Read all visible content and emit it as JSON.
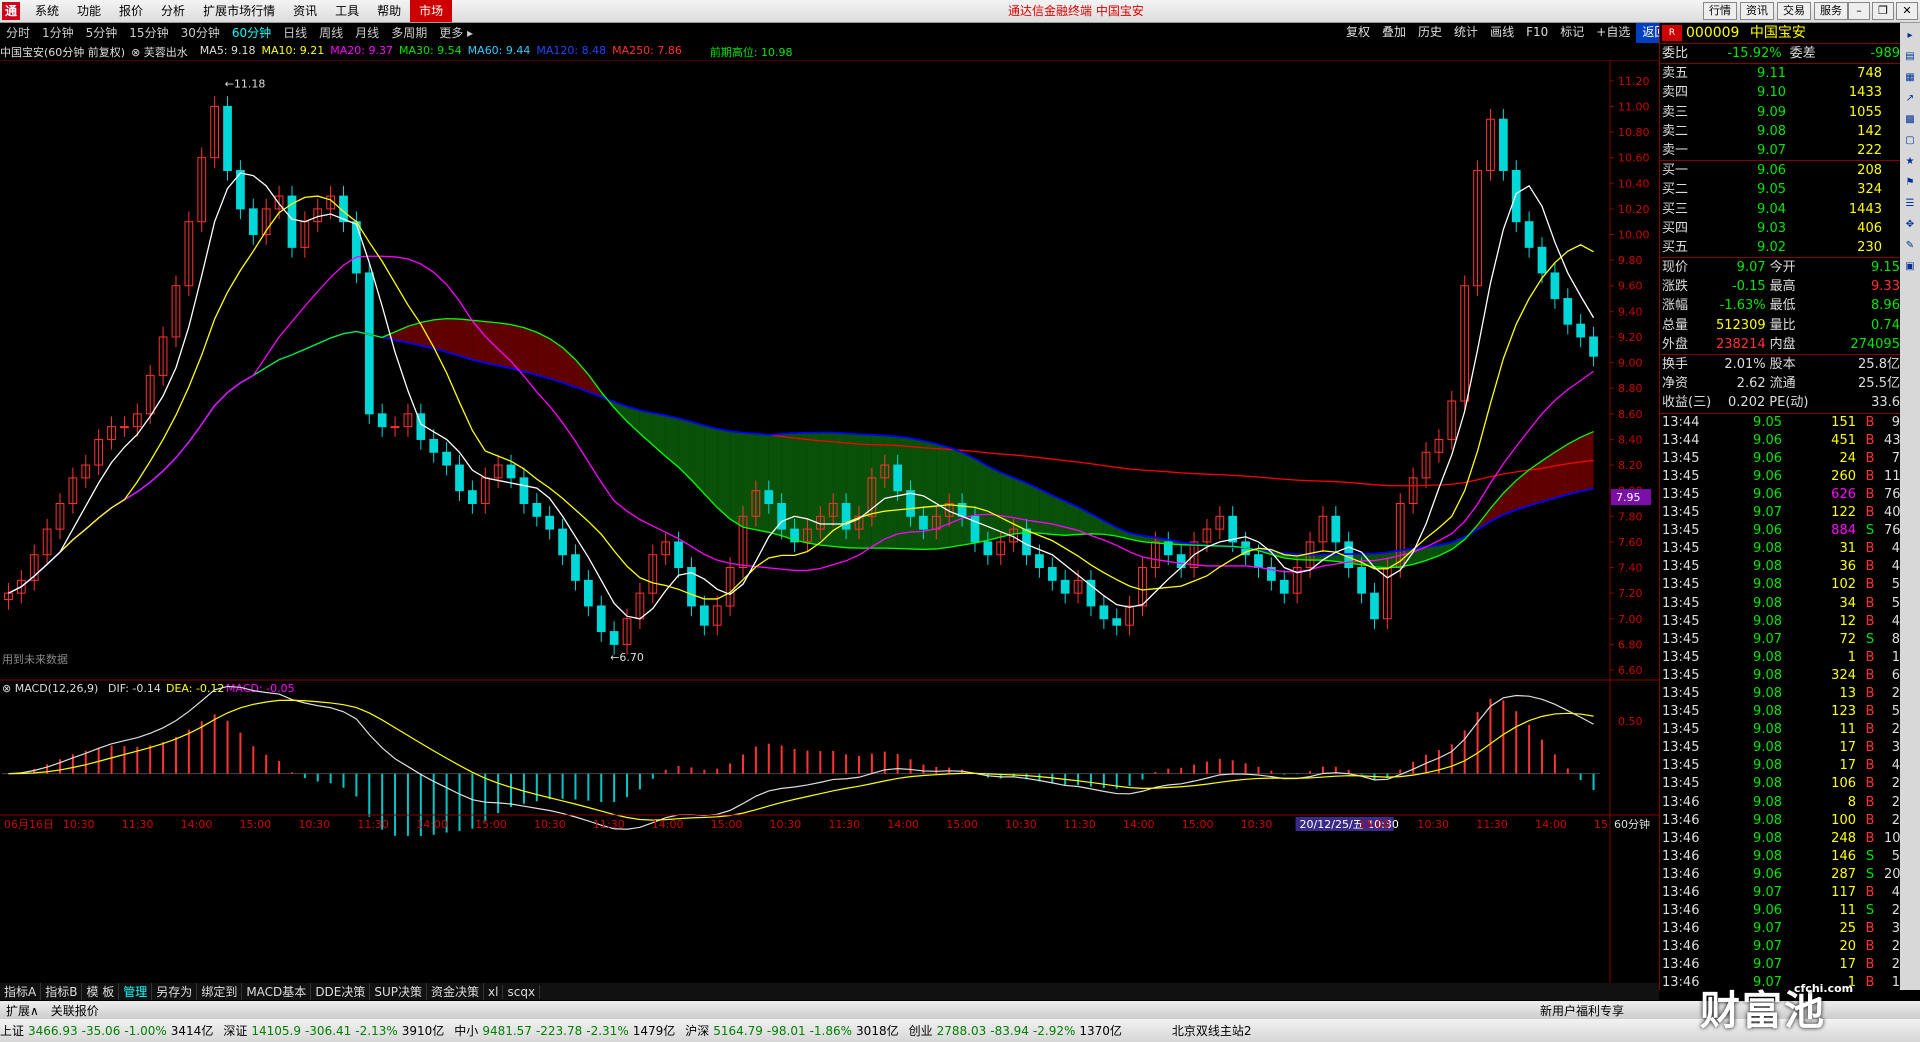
{
  "menu": {
    "items": [
      "系统",
      "功能",
      "报价",
      "分析",
      "扩展市场行情",
      "资讯",
      "工具",
      "帮助",
      "市场"
    ],
    "active_index": 8,
    "app_title": "通达信金融终端  中国宝安",
    "right_buttons": [
      "行情",
      "资讯",
      "交易",
      "服务"
    ]
  },
  "periods": {
    "items": [
      "分时",
      "1分钟",
      "5分钟",
      "15分钟",
      "30分钟",
      "60分钟",
      "日线",
      "周线",
      "月线",
      "多周期",
      "更多 ▸"
    ],
    "selected_index": 5
  },
  "toolbar_right": [
    "复权",
    "叠加",
    "历史",
    "统计",
    "画线",
    "F10",
    "标记",
    "+自选",
    "返回"
  ],
  "chart_info": {
    "name": "中国宝安(60分钟 前复权)",
    "indicator": "芙蓉出水",
    "ma5": "MA5: 9.18",
    "ma10": "MA10: 9.21",
    "ma20": "MA20: 9.37",
    "ma30": "MA30: 9.54",
    "ma60": "MA60: 9.44",
    "ma120": "MA120: 8.48",
    "ma250": "MA250: 7.86",
    "prev_high": "前期高位: 10.98",
    "future_note": "用到未来数据",
    "high_label": "11.18",
    "low_label": "6.70",
    "cur_price_tag": "7.95",
    "colors": {
      "ma5": "#ffffff",
      "ma10": "#ffff00",
      "ma20": "#ff00ff",
      "ma30": "#00ff00",
      "ma60": "#0000ff",
      "ma120": "#ff0000"
    }
  },
  "chart_data": {
    "type": "candlestick",
    "period": "60分钟",
    "ylim": [
      6.6,
      11.3
    ],
    "yticks": [
      11.2,
      11.0,
      10.8,
      10.6,
      10.4,
      10.2,
      10.0,
      9.8,
      9.6,
      9.4,
      9.2,
      9.0,
      8.8,
      8.6,
      8.4,
      8.2,
      8.0,
      7.8,
      7.6,
      7.4,
      7.2,
      7.0,
      6.8,
      6.6
    ],
    "close": [
      7.2,
      7.3,
      7.5,
      7.7,
      7.9,
      8.1,
      8.2,
      8.4,
      8.5,
      8.5,
      8.6,
      8.9,
      9.2,
      9.6,
      10.1,
      10.6,
      11.0,
      10.5,
      10.2,
      10.0,
      10.2,
      10.3,
      9.9,
      10.1,
      10.2,
      10.3,
      10.1,
      9.7,
      8.6,
      8.5,
      8.5,
      8.6,
      8.4,
      8.3,
      8.2,
      8.0,
      7.9,
      8.1,
      8.2,
      8.1,
      7.9,
      7.8,
      7.7,
      7.5,
      7.3,
      7.1,
      6.9,
      6.8,
      7.0,
      7.2,
      7.5,
      7.6,
      7.4,
      7.1,
      6.95,
      7.1,
      7.4,
      7.8,
      8.0,
      7.9,
      7.7,
      7.6,
      7.7,
      7.8,
      7.9,
      7.7,
      7.8,
      8.1,
      8.2,
      8.0,
      7.8,
      7.7,
      7.8,
      7.9,
      7.8,
      7.6,
      7.5,
      7.6,
      7.7,
      7.5,
      7.4,
      7.3,
      7.2,
      7.3,
      7.1,
      7.0,
      6.95,
      7.1,
      7.4,
      7.6,
      7.5,
      7.4,
      7.6,
      7.7,
      7.8,
      7.6,
      7.5,
      7.4,
      7.3,
      7.2,
      7.4,
      7.6,
      7.8,
      7.6,
      7.4,
      7.2,
      7.0,
      7.4,
      7.9,
      8.1,
      8.3,
      8.4,
      8.7,
      9.6,
      10.5,
      10.9,
      10.5,
      10.1,
      9.9,
      9.7,
      9.5,
      9.3,
      9.2,
      9.05
    ],
    "yaxis_label": "60分钟",
    "date_labels": [
      "06月16日",
      "10:30",
      "11:30",
      "14:00",
      "15:00",
      "10:30",
      "11:30",
      "14:00",
      "15:00",
      "10:30",
      "11:30",
      "14:00",
      "15:00",
      "10:30",
      "11:30",
      "14:00",
      "15:00",
      "10:30",
      "11:30",
      "14:00",
      "15:00",
      "10:30",
      "20/12/25/五 10:30",
      "15:00",
      "10:30",
      "11:30",
      "14:00",
      "15"
    ],
    "macd": {
      "label": "MACD(12,26,9)",
      "dif": "DIF: -0.14",
      "dea": "DEA: -0.12",
      "macd": "MACD: -0.05",
      "yticks": [
        0.5
      ],
      "ylim": [
        -0.25,
        0.7
      ]
    }
  },
  "quote": {
    "code": "000009",
    "name": "中国宝安",
    "weibi_label": "委比",
    "weibi": "-15.92%",
    "weicha_label": "委差",
    "weicha": "-989",
    "asks": [
      {
        "label": "卖五",
        "price": "9.11",
        "vol": "748"
      },
      {
        "label": "卖四",
        "price": "9.10",
        "vol": "1433"
      },
      {
        "label": "卖三",
        "price": "9.09",
        "vol": "1055"
      },
      {
        "label": "卖二",
        "price": "9.08",
        "vol": "142"
      },
      {
        "label": "卖一",
        "price": "9.07",
        "vol": "222"
      }
    ],
    "bids": [
      {
        "label": "买一",
        "price": "9.06",
        "vol": "208"
      },
      {
        "label": "买二",
        "price": "9.05",
        "vol": "324"
      },
      {
        "label": "买三",
        "price": "9.04",
        "vol": "1443"
      },
      {
        "label": "买四",
        "price": "9.03",
        "vol": "406"
      },
      {
        "label": "买五",
        "price": "9.02",
        "vol": "230"
      }
    ],
    "stats": [
      [
        {
          "l": "现价",
          "v": "9.07",
          "c": "green"
        },
        {
          "l": "今开",
          "v": "9.15",
          "c": "green"
        }
      ],
      [
        {
          "l": "涨跌",
          "v": "-0.15",
          "c": "green"
        },
        {
          "l": "最高",
          "v": "9.33",
          "c": "red"
        }
      ],
      [
        {
          "l": "涨幅",
          "v": "-1.63%",
          "c": "green"
        },
        {
          "l": "最低",
          "v": "8.96",
          "c": "green"
        }
      ],
      [
        {
          "l": "总量",
          "v": "512309",
          "c": "yellow"
        },
        {
          "l": "量比",
          "v": "0.74",
          "c": "green"
        }
      ],
      [
        {
          "l": "外盘",
          "v": "238214",
          "c": "red"
        },
        {
          "l": "内盘",
          "v": "274095",
          "c": "green"
        }
      ]
    ],
    "stats2": [
      [
        {
          "l": "换手",
          "v": "2.01%",
          "c": "white"
        },
        {
          "l": "股本",
          "v": "25.8亿",
          "c": "white"
        }
      ],
      [
        {
          "l": "净资",
          "v": "2.62",
          "c": "white"
        },
        {
          "l": "流通",
          "v": "25.5亿",
          "c": "white"
        }
      ],
      [
        {
          "l": "收益(三)",
          "v": "0.202",
          "c": "white"
        },
        {
          "l": "PE(动)",
          "v": "33.6",
          "c": "white"
        }
      ]
    ],
    "ticks": [
      {
        "t": "13:44",
        "p": "9.05",
        "v": "151",
        "bs": "B",
        "n": "9",
        "pc": "green",
        "vc": "yellow"
      },
      {
        "t": "13:44",
        "p": "9.06",
        "v": "451",
        "bs": "B",
        "n": "43",
        "pc": "green",
        "vc": "yellow"
      },
      {
        "t": "13:45",
        "p": "9.06",
        "v": "24",
        "bs": "B",
        "n": "7",
        "pc": "green",
        "vc": "yellow"
      },
      {
        "t": "13:45",
        "p": "9.06",
        "v": "260",
        "bs": "B",
        "n": "11",
        "pc": "green",
        "vc": "yellow"
      },
      {
        "t": "13:45",
        "p": "9.06",
        "v": "626",
        "bs": "B",
        "n": "76",
        "pc": "green",
        "vc": "magenta"
      },
      {
        "t": "13:45",
        "p": "9.07",
        "v": "122",
        "bs": "B",
        "n": "40",
        "pc": "green",
        "vc": "yellow"
      },
      {
        "t": "13:45",
        "p": "9.06",
        "v": "884",
        "bs": "S",
        "n": "76",
        "pc": "green",
        "vc": "magenta"
      },
      {
        "t": "13:45",
        "p": "9.08",
        "v": "31",
        "bs": "B",
        "n": "4",
        "pc": "green",
        "vc": "yellow"
      },
      {
        "t": "13:45",
        "p": "9.08",
        "v": "36",
        "bs": "B",
        "n": "4",
        "pc": "green",
        "vc": "yellow"
      },
      {
        "t": "13:45",
        "p": "9.08",
        "v": "102",
        "bs": "B",
        "n": "5",
        "pc": "green",
        "vc": "yellow"
      },
      {
        "t": "13:45",
        "p": "9.08",
        "v": "34",
        "bs": "B",
        "n": "5",
        "pc": "green",
        "vc": "yellow"
      },
      {
        "t": "13:45",
        "p": "9.08",
        "v": "12",
        "bs": "B",
        "n": "4",
        "pc": "green",
        "vc": "yellow"
      },
      {
        "t": "13:45",
        "p": "9.07",
        "v": "72",
        "bs": "S",
        "n": "8",
        "pc": "green",
        "vc": "yellow"
      },
      {
        "t": "13:45",
        "p": "9.08",
        "v": "1",
        "bs": "B",
        "n": "1",
        "pc": "green",
        "vc": "yellow"
      },
      {
        "t": "13:45",
        "p": "9.08",
        "v": "324",
        "bs": "B",
        "n": "6",
        "pc": "green",
        "vc": "yellow"
      },
      {
        "t": "13:45",
        "p": "9.08",
        "v": "13",
        "bs": "B",
        "n": "2",
        "pc": "green",
        "vc": "yellow"
      },
      {
        "t": "13:45",
        "p": "9.08",
        "v": "123",
        "bs": "B",
        "n": "5",
        "pc": "green",
        "vc": "yellow"
      },
      {
        "t": "13:45",
        "p": "9.08",
        "v": "11",
        "bs": "B",
        "n": "2",
        "pc": "green",
        "vc": "yellow"
      },
      {
        "t": "13:45",
        "p": "9.08",
        "v": "17",
        "bs": "B",
        "n": "3",
        "pc": "green",
        "vc": "yellow"
      },
      {
        "t": "13:45",
        "p": "9.08",
        "v": "17",
        "bs": "B",
        "n": "4",
        "pc": "green",
        "vc": "yellow"
      },
      {
        "t": "13:45",
        "p": "9.08",
        "v": "106",
        "bs": "B",
        "n": "2",
        "pc": "green",
        "vc": "yellow"
      },
      {
        "t": "13:46",
        "p": "9.08",
        "v": "8",
        "bs": "B",
        "n": "2",
        "pc": "green",
        "vc": "yellow"
      },
      {
        "t": "13:46",
        "p": "9.08",
        "v": "100",
        "bs": "B",
        "n": "2",
        "pc": "green",
        "vc": "yellow"
      },
      {
        "t": "13:46",
        "p": "9.08",
        "v": "248",
        "bs": "B",
        "n": "10",
        "pc": "green",
        "vc": "yellow"
      },
      {
        "t": "13:46",
        "p": "9.08",
        "v": "146",
        "bs": "S",
        "n": "5",
        "pc": "green",
        "vc": "yellow"
      },
      {
        "t": "13:46",
        "p": "9.06",
        "v": "287",
        "bs": "S",
        "n": "20",
        "pc": "green",
        "vc": "yellow"
      },
      {
        "t": "13:46",
        "p": "9.07",
        "v": "117",
        "bs": "B",
        "n": "4",
        "pc": "green",
        "vc": "yellow"
      },
      {
        "t": "13:46",
        "p": "9.06",
        "v": "11",
        "bs": "S",
        "n": "2",
        "pc": "green",
        "vc": "yellow"
      },
      {
        "t": "13:46",
        "p": "9.07",
        "v": "25",
        "bs": "B",
        "n": "3",
        "pc": "green",
        "vc": "yellow"
      },
      {
        "t": "13:46",
        "p": "9.07",
        "v": "20",
        "bs": "B",
        "n": "2",
        "pc": "green",
        "vc": "yellow"
      },
      {
        "t": "13:46",
        "p": "9.07",
        "v": "17",
        "bs": "B",
        "n": "2",
        "pc": "green",
        "vc": "yellow"
      },
      {
        "t": "13:46",
        "p": "9.07",
        "v": "1",
        "bs": "B",
        "n": "1",
        "pc": "green",
        "vc": "yellow"
      }
    ]
  },
  "bottom_tabs": [
    "指标A",
    "指标B",
    "模 板",
    "管理",
    "另存为",
    "绑定到",
    "MACD基本",
    "DDE决策",
    "SUP决策",
    "资金决策",
    "xl",
    "scqx"
  ],
  "bottom_tabs_active": 3,
  "extbar": {
    "items": [
      "扩展∧",
      "关联报价"
    ],
    "promo": "新用户福利专享"
  },
  "status": [
    {
      "name": "上证",
      "val": "3466.93",
      "chg": "-35.06",
      "pct": "-1.00%",
      "amt": "3414亿"
    },
    {
      "name": "深证",
      "val": "14105.9",
      "chg": "-306.41",
      "pct": "-2.13%",
      "amt": "3910亿"
    },
    {
      "name": "中小",
      "val": "9481.57",
      "chg": "-223.78",
      "pct": "-2.31%",
      "amt": "1479亿"
    },
    {
      "name": "沪深",
      "val": "5164.79",
      "chg": "-98.01",
      "pct": "-1.86%",
      "amt": "3018亿"
    },
    {
      "name": "创业",
      "val": "2788.03",
      "chg": "-83.94",
      "pct": "-2.92%",
      "amt": "1370亿"
    }
  ],
  "status_server": "北京双线主站2",
  "watermark": {
    "text": "财富池",
    "sub": "cfchi.com"
  }
}
